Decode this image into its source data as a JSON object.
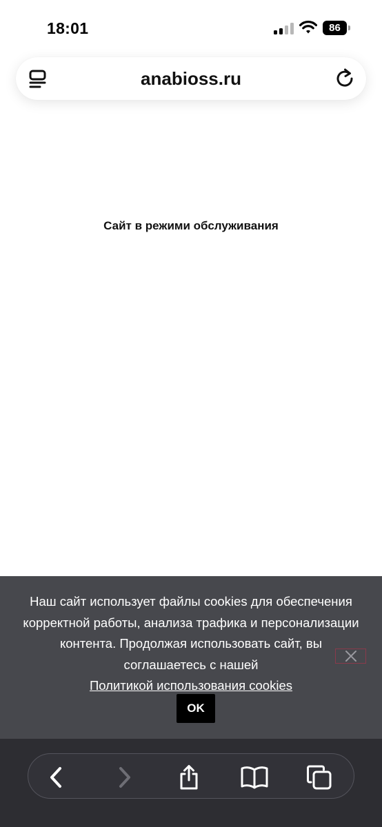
{
  "status_bar": {
    "time": "18:01",
    "battery_level": "86",
    "icons": [
      "signal-icon",
      "wifi-icon",
      "battery-icon"
    ]
  },
  "address_bar": {
    "url": "anabioss.ru",
    "icons": [
      "tabs-icon",
      "reload-icon"
    ]
  },
  "main": {
    "message": "Сайт в режими обслуживания"
  },
  "cookie_banner": {
    "text": "Наш сайт использует файлы cookies для обеспечения корректной работы, анализа трафика и персонализации контента. Продолжая использовать сайт, вы соглашаетесь с нашей",
    "link_label": "Политикой использования cookies",
    "ok_label": "OK",
    "colors": {
      "background": "#47484d",
      "button": "#000000",
      "close_border": "#8a3a4c"
    }
  },
  "toolbar": {
    "icons": [
      "back-icon",
      "forward-icon",
      "share-icon",
      "bookmarks-icon",
      "tabs-overview-icon"
    ]
  }
}
